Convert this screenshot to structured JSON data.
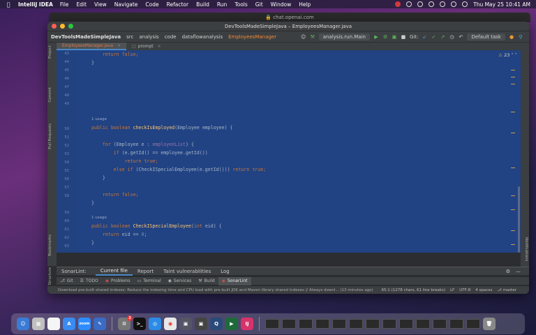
{
  "menubar": {
    "app_name": "IntelliJ IDEA",
    "items": [
      "File",
      "Edit",
      "View",
      "Navigate",
      "Code",
      "Refactor",
      "Build",
      "Run",
      "Tools",
      "Git",
      "Window",
      "Help"
    ],
    "clock": "Thu May 25  10:41 AM"
  },
  "browser": {
    "url": "chat.openai.com"
  },
  "window": {
    "title": "DevToolsMadeSimpleJava – EmployeesManager.java"
  },
  "navbar": {
    "project": "DevToolsMadeSimpleJava",
    "crumbs": [
      "src",
      "analysis",
      "code",
      "dataflowanalysis"
    ],
    "file": "EmployeesManager",
    "run_config": "analysis.run.Main",
    "git_label": "Git:",
    "task": "Default task"
  },
  "tabs": [
    {
      "label": "EmployeesManager.java",
      "active": true
    },
    {
      "label": "prompt",
      "active": false
    }
  ],
  "side_labels": {
    "left": [
      "Project",
      "Commit",
      "Pull Requests",
      "Bookmarks",
      "Structure"
    ],
    "right": "Notifications"
  },
  "editor": {
    "warning_count": "23",
    "line_numbers": [
      "43",
      "44",
      "45",
      "46",
      "47",
      "48",
      "49",
      "50",
      "51",
      "52",
      "53",
      "54",
      "55",
      "56",
      "57",
      "58",
      "59",
      "60",
      "61",
      "62",
      "63",
      "64",
      "65"
    ],
    "usage_label": "1 usage",
    "tokens": {
      "return": "return",
      "false": "false;",
      "brace_close": "}",
      "public": "public",
      "boolean": "boolean",
      "m1_name": "checkIsEmployed",
      "m1_params": "(Employee employee) {",
      "for": "for",
      "for_head": " (Employee e : ",
      "employee_list": "employeeList",
      "for_tail": ") {",
      "if": "if",
      "if_cond": " (e.getId() == employee.getId())",
      "true": "true;",
      "else": "else",
      "elseif_cond": " (CheckISpecialEmployee(e.getId())) ",
      "m2_name": "CheckISpecialEmployee",
      "int": "int",
      "m2_params_tail": " eid) {",
      "open_paren": "(",
      "eid_cmp": " eid == ",
      "zero": "0",
      "semicolon": ";"
    }
  },
  "sonarlint": {
    "title": "SonarLint:",
    "tabs": [
      "Current file",
      "Report",
      "Taint vulnerabilities",
      "Log"
    ]
  },
  "tool_windows": [
    "Git",
    "TODO",
    "Problems",
    "Terminal",
    "Services",
    "Build",
    "SonarLint"
  ],
  "statusbar": {
    "message": "Download pre-built shared indexes: Reduce the indexing time and CPU load with pre-built JDK and Maven library shared indexes // Always downl... (13 minutes ago)",
    "position": "65:1 (1278 chars, 61 line breaks)",
    "line_sep": "LF",
    "encoding": "UTF-8",
    "indent": "4 spaces",
    "branch": "master"
  },
  "dock": {
    "zoom_label": "zoom",
    "badge": "2"
  },
  "colors": {
    "editor_bg": "#214283",
    "keyword": "#cc7832",
    "method": "#ffc66d",
    "field": "#9876aa",
    "number": "#6897bb"
  }
}
